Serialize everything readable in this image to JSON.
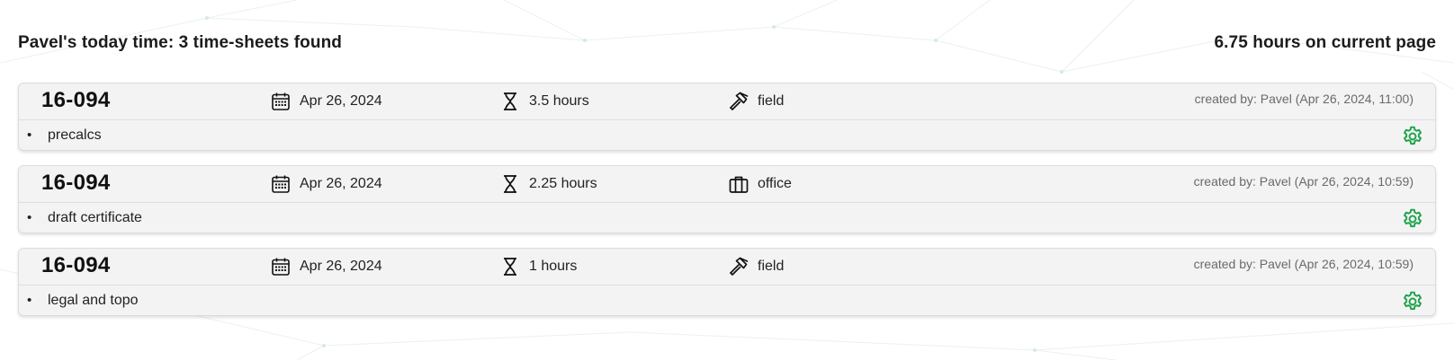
{
  "header": {
    "title": "Pavel's today time: 3 time-sheets found",
    "total": "6.75 hours on current page"
  },
  "colors": {
    "accent_green": "#1ea34a",
    "card_bg": "#f3f3f4"
  },
  "entries": [
    {
      "project": "16-094",
      "date": "Apr 26, 2024",
      "hours": "3.5 hours",
      "type": "field",
      "type_icon": "hammer-icon",
      "created": "created by: Pavel (Apr 26, 2024, 11:00)",
      "bullet": "•",
      "description": "precalcs"
    },
    {
      "project": "16-094",
      "date": "Apr 26, 2024",
      "hours": "2.25 hours",
      "type": "office",
      "type_icon": "briefcase-icon",
      "created": "created by: Pavel (Apr 26, 2024, 10:59)",
      "bullet": "•",
      "description": "draft certificate"
    },
    {
      "project": "16-094",
      "date": "Apr 26, 2024",
      "hours": "1 hours",
      "type": "field",
      "type_icon": "hammer-icon",
      "created": "created by: Pavel (Apr 26, 2024, 10:59)",
      "bullet": "•",
      "description": "legal and topo"
    }
  ]
}
